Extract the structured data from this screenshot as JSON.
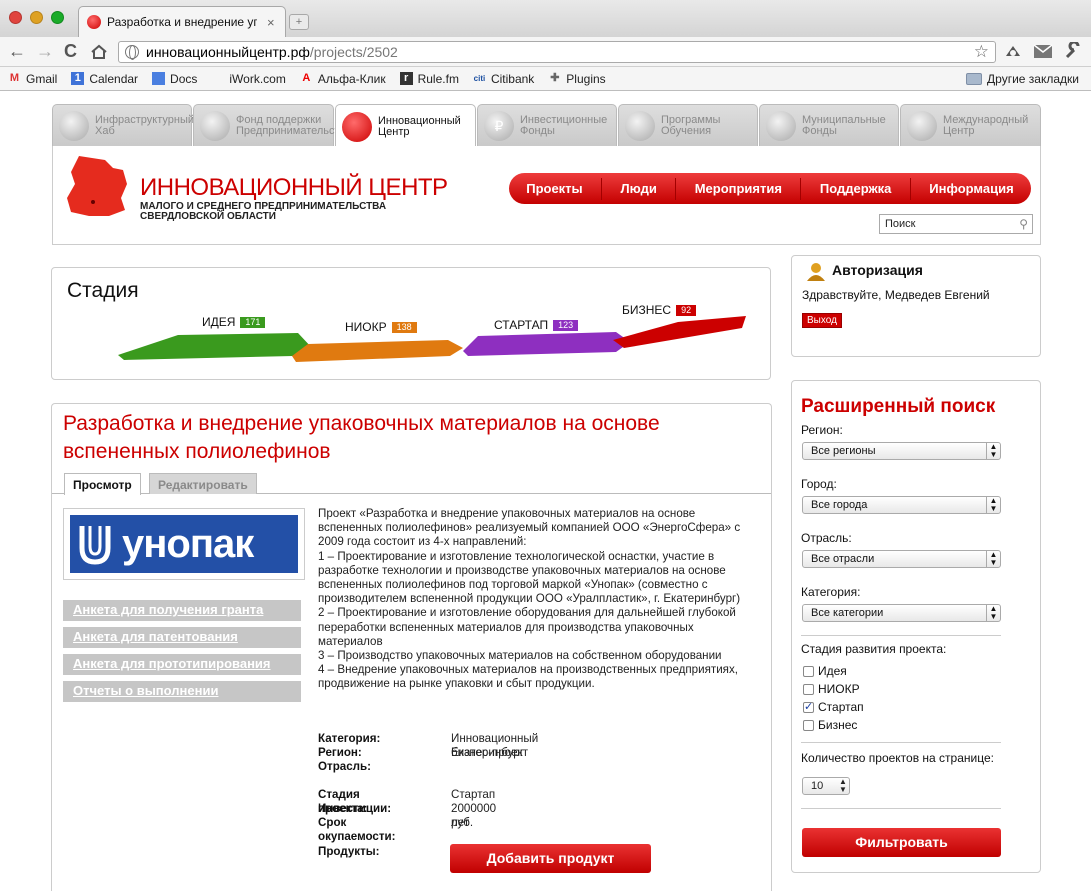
{
  "browser": {
    "tab_title": "Разработка и внедрение упа",
    "tab_close": "×",
    "new_tab": "+",
    "url_host": "инновационныйцентр.рф",
    "url_path": "/projects/2502",
    "nav_back": "←",
    "nav_forward": "→",
    "nav_reload": "C",
    "bookmark_star": "☆",
    "bookmarks": [
      "Gmail",
      "Calendar",
      "Docs",
      "iWork.com",
      "Альфа-Клик",
      "Rule.fm",
      "Citibank",
      "Plugins"
    ],
    "other_bookmarks": "Другие закладки"
  },
  "site_tabs": [
    {
      "label": "Инфраструктурный Хаб",
      "active": false
    },
    {
      "label": "Фонд поддержки Предпринимательства",
      "active": false
    },
    {
      "label": "Инновационный Центр",
      "active": true
    },
    {
      "label": "Инвестиционные Фонды",
      "active": false
    },
    {
      "label": "Программы Обучения",
      "active": false
    },
    {
      "label": "Муниципальные Фонды",
      "active": false
    },
    {
      "label": "Международный Центр",
      "active": false
    }
  ],
  "header": {
    "title": "ИННОВАЦИОННЫЙ ЦЕНТР",
    "subtitle": "МАЛОГО И СРЕДНЕГО ПРЕДПРИНИМАТЕЛЬСТВА СВЕРДЛОВСКОЙ ОБЛАСТИ",
    "nav": [
      "Проекты",
      "Люди",
      "Мероприятия",
      "Поддержка",
      "Информация"
    ],
    "search_placeholder": "Поиск",
    "search_icon": "⚲"
  },
  "stage": {
    "title": "Стадия",
    "stages": [
      {
        "label": "ИДЕЯ",
        "count": "171",
        "color": "#3a9a1e"
      },
      {
        "label": "НИОКР",
        "count": "138",
        "color": "#e07a10"
      },
      {
        "label": "СТАРТАП",
        "count": "123",
        "color": "#8e2fc0"
      },
      {
        "label": "БИЗНЕС",
        "count": "92",
        "color": "#cc0000"
      }
    ]
  },
  "auth": {
    "title": "Авторизация",
    "greeting": "Здравствуйте, Медведев Евгений",
    "logout": "Выход"
  },
  "project": {
    "title": "Разработка и внедрение упаковочных материалов на основе вспененных полиолефинов",
    "tabs": [
      "Просмотр",
      "Редактировать"
    ],
    "logo_text": "унопак",
    "side_links": [
      "Анкета для получения гранта",
      "Анкета для патентования",
      "Анкета для прототипирования",
      "Отчеты о выполнении"
    ],
    "description": [
      "Проект «Разработка и внедрение упаковочных материалов на основе вспененных полиолефинов» реализуемый компанией ООО «ЭнергоСфера» с 2009 года состоит из 4-х направлений:",
      "1 – Проектирование и изготовление технологической оснастки, участие в разработке технологии и производстве упаковочных материалов на основе вспененных полиолефинов под торговой маркой «Унопак» (совместно с производителем вспененной продукции ООО «Уралпластик», г. Екатеринбург)",
      "2 – Проектирование и изготовление оборудования для дальнейшей глубокой переработки вспененных материалов для производства упаковочных материалов",
      "3 – Производство упаковочных материалов на собственном оборудовании",
      "4 – Внедрение упаковочных материалов на производственных предприятиях, продвижение на рынке упаковки и сбыт продукции."
    ],
    "info": {
      "category_label": "Категория:",
      "category_value": "Инновационный бизнес-проект",
      "region_label": "Регион:",
      "region_value": "Екатеринбург",
      "industry_label": "Отрасль:",
      "industry_value": "",
      "stage_label": "Стадия проекта:",
      "stage_value": "Стартап",
      "invest_label": "Инвестиции:",
      "invest_value": "2000000 руб.",
      "payback_label": "Срок окупаемости:",
      "payback_value": "лет",
      "products_label": "Продукты:"
    },
    "add_product": "Добавить продукт"
  },
  "adv_search": {
    "title": "Расширенный поиск",
    "region_label": "Регион:",
    "region_value": "Все регионы",
    "city_label": "Город:",
    "city_value": "Все города",
    "industry_label": "Отрасль:",
    "industry_value": "Все отрасли",
    "category_label": "Категория:",
    "category_value": "Все категории",
    "stage_label": "Стадия развития проекта:",
    "stages": [
      {
        "label": "Идея",
        "checked": false
      },
      {
        "label": "НИОКР",
        "checked": false
      },
      {
        "label": "Стартап",
        "checked": true
      },
      {
        "label": "Бизнес",
        "checked": false
      }
    ],
    "per_page_label": "Количество проектов на странице:",
    "per_page_value": "10",
    "filter_button": "Фильтровать"
  }
}
